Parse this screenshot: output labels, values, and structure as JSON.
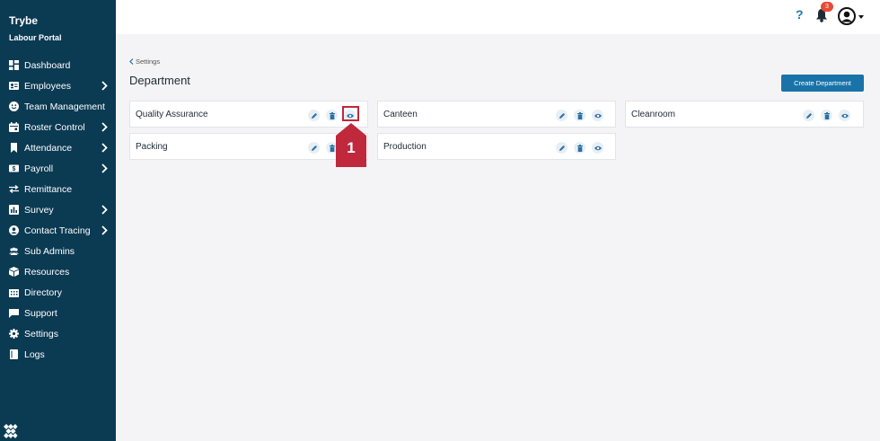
{
  "app": {
    "title": "Trybe",
    "subtitle": "Labour Portal"
  },
  "sidebar": {
    "items": [
      {
        "label": "Dashboard",
        "icon": "dashboard-icon",
        "has_submenu": false
      },
      {
        "label": "Employees",
        "icon": "id-card-icon",
        "has_submenu": true
      },
      {
        "label": "Team Management",
        "icon": "smile-icon",
        "has_submenu": false
      },
      {
        "label": "Roster Control",
        "icon": "calendar-icon",
        "has_submenu": true
      },
      {
        "label": "Attendance",
        "icon": "bookmark-icon",
        "has_submenu": true
      },
      {
        "label": "Payroll",
        "icon": "money-icon",
        "has_submenu": true
      },
      {
        "label": "Remittance",
        "icon": "exchange-icon",
        "has_submenu": false
      },
      {
        "label": "Survey",
        "icon": "bar-chart-icon",
        "has_submenu": true
      },
      {
        "label": "Contact Tracing",
        "icon": "user-circle-icon",
        "has_submenu": true
      },
      {
        "label": "Sub Admins",
        "icon": "users-icon",
        "has_submenu": false
      },
      {
        "label": "Resources",
        "icon": "box-icon",
        "has_submenu": false
      },
      {
        "label": "Directory",
        "icon": "building-icon",
        "has_submenu": false
      },
      {
        "label": "Support",
        "icon": "chat-icon",
        "has_submenu": false
      },
      {
        "label": "Settings",
        "icon": "gear-icon",
        "has_submenu": false
      },
      {
        "label": "Logs",
        "icon": "book-icon",
        "has_submenu": false
      }
    ]
  },
  "topbar": {
    "help": "?",
    "notification_count": "3"
  },
  "breadcrumb": {
    "label": "Settings"
  },
  "page": {
    "title": "Department",
    "create_button": "Create Department"
  },
  "departments": [
    {
      "name": "Quality Assurance"
    },
    {
      "name": "Canteen"
    },
    {
      "name": "Cleanroom"
    },
    {
      "name": "Packing"
    },
    {
      "name": "Production"
    }
  ],
  "annotation": {
    "step": "1"
  },
  "colors": {
    "sidebar": "#0b3a53",
    "accent": "#1a73a8",
    "badge": "#e54b36",
    "marker": "#c0283c"
  }
}
